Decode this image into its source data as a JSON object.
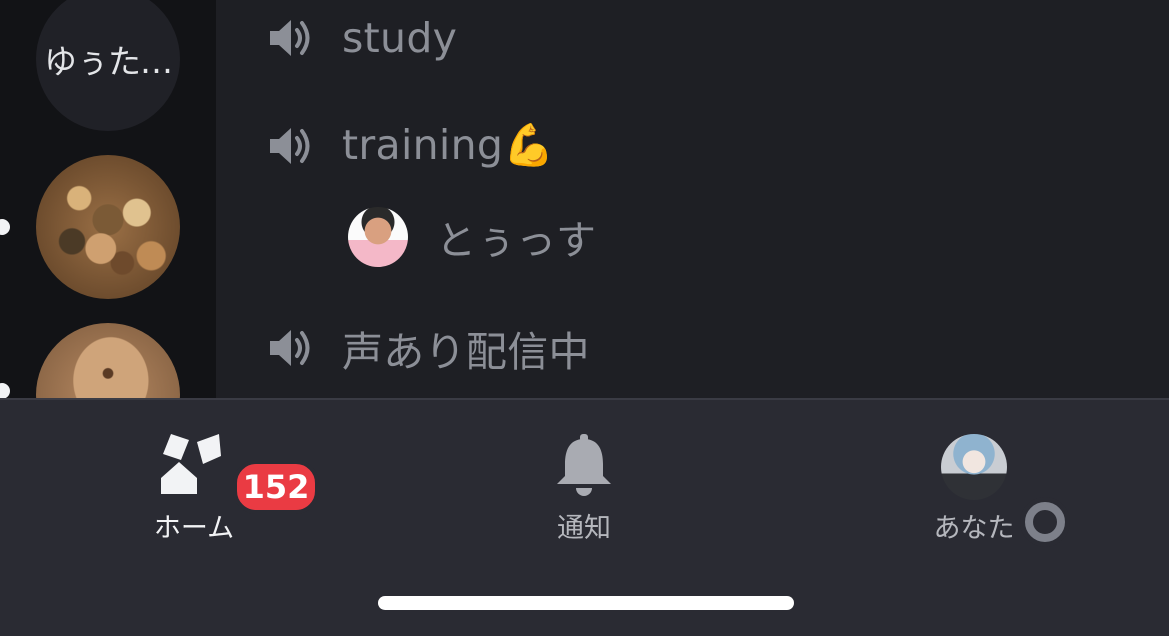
{
  "servers": [
    {
      "label": "ゆぅた…",
      "kind": "text"
    },
    {
      "label": "",
      "kind": "image",
      "unread": true
    },
    {
      "label": "",
      "kind": "image",
      "unread": true
    }
  ],
  "channels": {
    "study": {
      "name": "study",
      "icon": "speaker-icon"
    },
    "training": {
      "name": "training💪",
      "icon": "speaker-icon"
    },
    "training_user": {
      "name": "とぅっす"
    },
    "live": {
      "name": "声あり配信中",
      "icon": "speaker-icon"
    }
  },
  "tabbar": {
    "home": {
      "label": "ホーム",
      "badge": "152",
      "icon": "home-icon"
    },
    "notifications": {
      "label": "通知",
      "icon": "bell-icon"
    },
    "you": {
      "label": "あなた",
      "icon": "avatar",
      "status": "offline"
    }
  },
  "colors": {
    "background": "#1e1f24",
    "rail": "#121316",
    "tabbar": "#2a2b33",
    "badge": "#ea3b43",
    "muted_text": "#8c8f97"
  }
}
